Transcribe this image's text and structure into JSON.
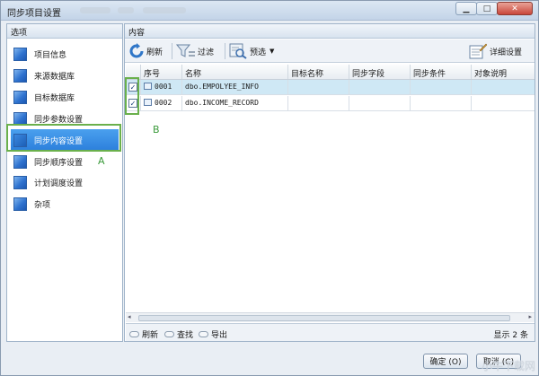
{
  "window": {
    "title": "同步项目设置",
    "close_label": "✕"
  },
  "sidebar": {
    "header": "选项",
    "items": [
      {
        "label": "项目信息"
      },
      {
        "label": "来源数据库"
      },
      {
        "label": "目标数据库"
      },
      {
        "label": "同步参数设置"
      },
      {
        "label": "同步内容设置",
        "selected": true
      },
      {
        "label": "同步顺序设置"
      },
      {
        "label": "计划调度设置"
      },
      {
        "label": "杂项"
      }
    ]
  },
  "annotations": {
    "a": "A",
    "b": "B"
  },
  "content": {
    "header": "内容",
    "toolbar": {
      "refresh": "刷新",
      "filter": "过滤",
      "preview": "预选",
      "detail_settings": "详细设置"
    },
    "columns": [
      "序号",
      "名称",
      "目标名称",
      "同步字段",
      "同步条件",
      "对象说明"
    ],
    "rows": [
      {
        "checked": true,
        "index": "0001",
        "name": "dbo.EMPOLYEE_INFO",
        "target": "",
        "fields": "",
        "condition": "",
        "desc": ""
      },
      {
        "checked": true,
        "index": "0002",
        "name": "dbo.INCOME_RECORD",
        "target": "",
        "fields": "",
        "condition": "",
        "desc": ""
      }
    ],
    "status": {
      "refresh": "刷新",
      "find": "查找",
      "export": "导出",
      "count_text": "显示 2 条"
    }
  },
  "footer": {
    "ok": "确定 (O)",
    "cancel": "取消 (C)"
  },
  "colors": {
    "selected_nav": "#2c7fdc",
    "selected_row": "#cfe8f5",
    "annotation": "#6ab04c"
  }
}
